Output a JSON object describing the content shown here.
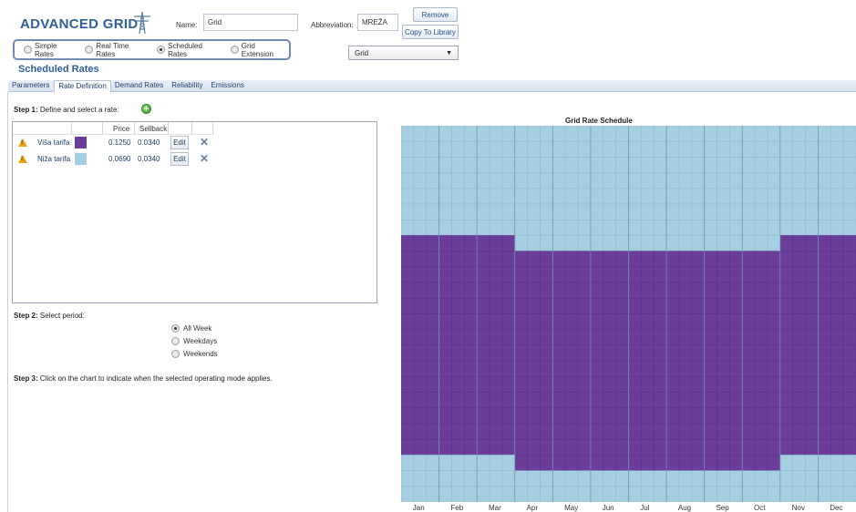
{
  "header": {
    "app_title": "ADVANCED GRID",
    "name_label": "Name:",
    "name_value": "Grid",
    "abbrev_label": "Abbreviation:",
    "abbrev_value": "MREŽA",
    "remove_label": "Remove",
    "copy_label": "Copy To Library",
    "grid_select": "Grid"
  },
  "rate_types": [
    {
      "label": "Simple Rates",
      "selected": false
    },
    {
      "label": "Real Time Rates",
      "selected": false
    },
    {
      "label": "Scheduled Rates",
      "selected": true
    },
    {
      "label": "Grid Extension",
      "selected": false
    }
  ],
  "section_title": "Scheduled Rates",
  "tabs": [
    "Parameters",
    "Rate Definition",
    "Demand Rates",
    "Reliability",
    "Emissions"
  ],
  "active_tab": "Rate Definition",
  "step1": {
    "bold": "Step 1:",
    "text": "Define and select a rate:"
  },
  "rate_table": {
    "headers": [
      "Price",
      "Sellback"
    ],
    "edit_label": "Edit",
    "rows": [
      {
        "name": "Viša tarifa",
        "color": "#6a3d9a",
        "price": "0.1250",
        "sellback": "0.0340"
      },
      {
        "name": "Niža tarifa",
        "color": "#a6cee3",
        "price": "0.0690",
        "sellback": "0.0340"
      }
    ]
  },
  "step2": {
    "bold": "Step 2:",
    "text": "Select period:"
  },
  "periods": [
    {
      "label": "All Week",
      "selected": true
    },
    {
      "label": "Weekdays",
      "selected": false
    },
    {
      "label": "Weekends",
      "selected": false
    }
  ],
  "step3": {
    "bold": "Step 3:",
    "text": "Click on the chart to indicate when the selected operating mode applies."
  },
  "schedule": {
    "title": "Grid Rate Schedule",
    "months": [
      "Jan",
      "Feb",
      "Mar",
      "Apr",
      "May",
      "Jun",
      "Jul",
      "Aug",
      "Sep",
      "Oct",
      "Nov",
      "Dec"
    ],
    "hours_per_day": 24,
    "colors": {
      "high": "#6a3d9a",
      "low": "#a6cee3"
    },
    "high_rate_hours_by_month": [
      [
        7,
        20
      ],
      [
        7,
        20
      ],
      [
        7,
        20
      ],
      [
        8,
        21
      ],
      [
        8,
        21
      ],
      [
        8,
        21
      ],
      [
        8,
        21
      ],
      [
        8,
        21
      ],
      [
        8,
        21
      ],
      [
        8,
        21
      ],
      [
        7,
        20
      ],
      [
        7,
        20
      ]
    ]
  }
}
